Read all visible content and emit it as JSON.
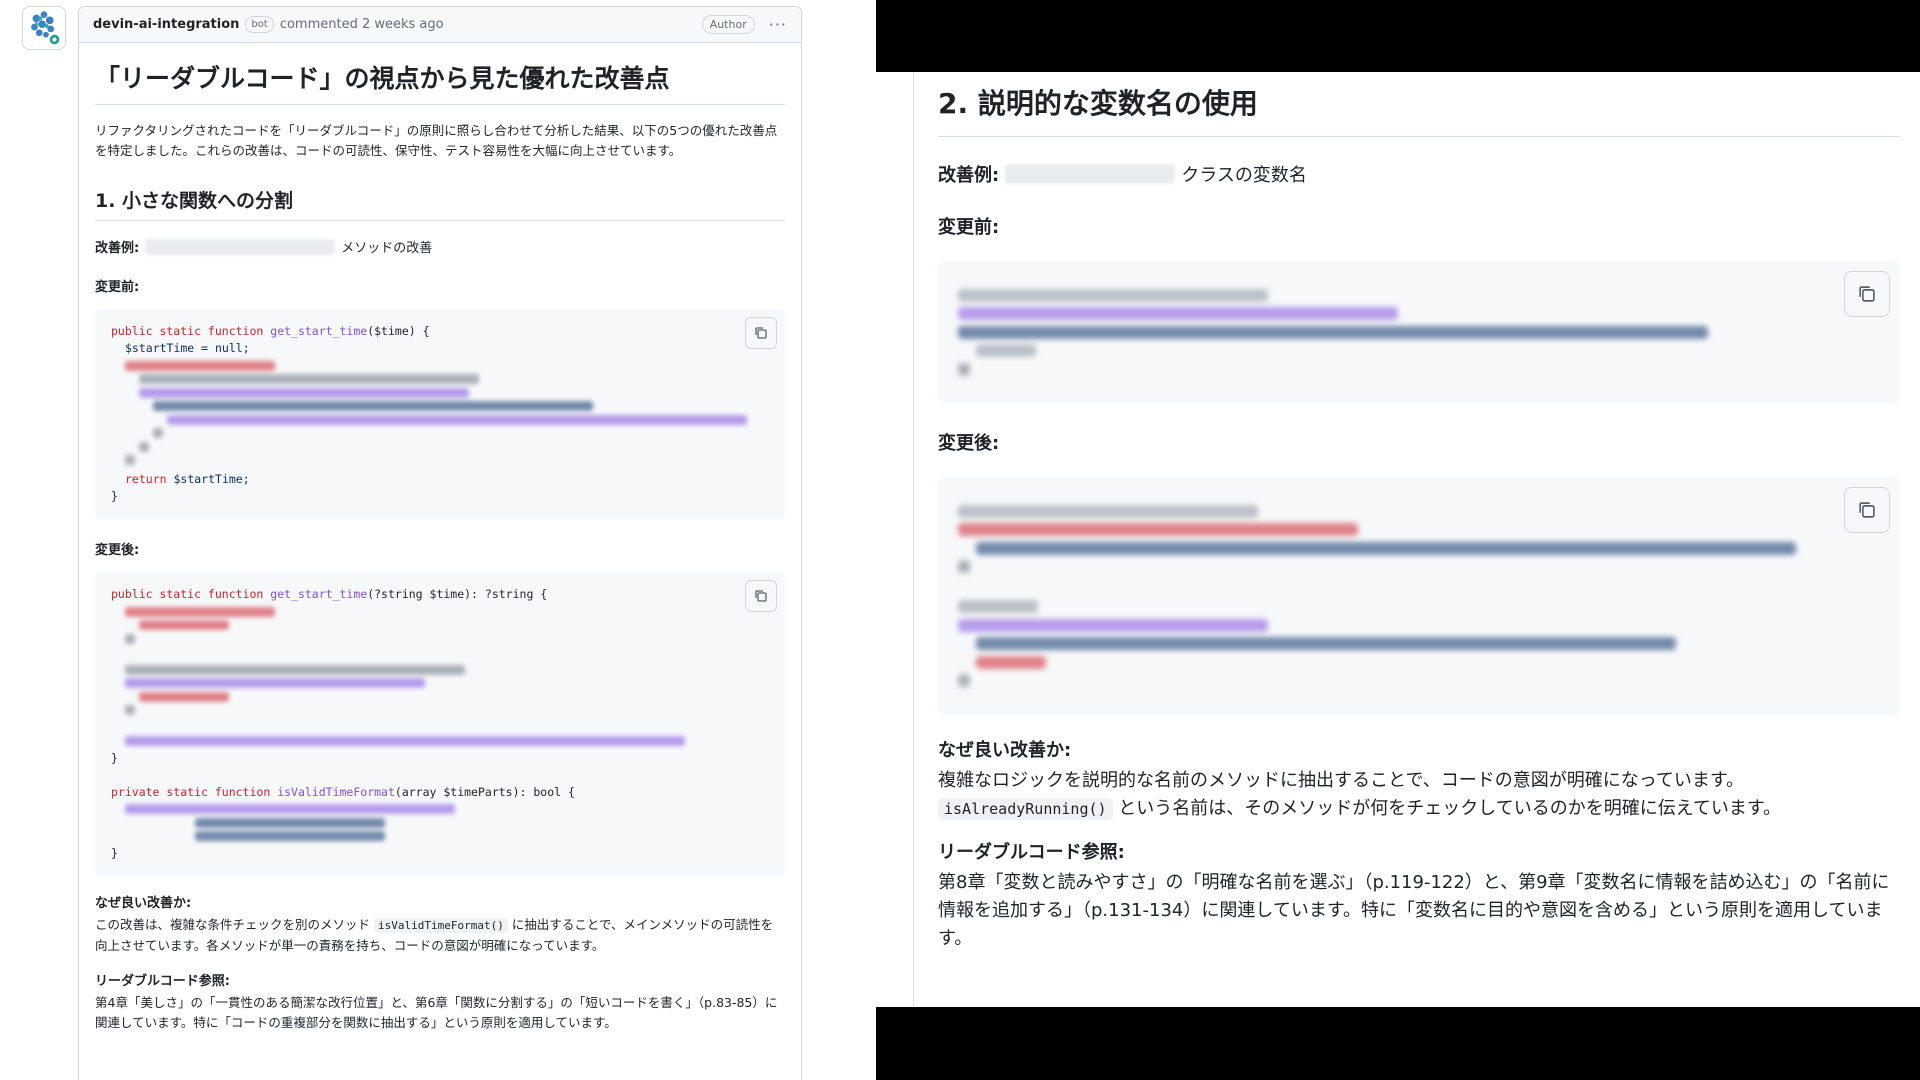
{
  "left": {
    "comment": {
      "author": "devin-ai-integration",
      "bot_badge": "bot",
      "commented": "commented 2 weeks ago",
      "author_badge": "Author",
      "more_icon": "kebab-horizontal-icon"
    },
    "title": "「リーダブルコード」の視点から見た優れた改善点",
    "intro": "リファクタリングされたコードを「リーダブルコード」の原則に照らし合わせて分析した結果、以下の5つの優れた改善点を特定しました。これらの改善は、コードの可読性、保守性、テスト容易性を大幅に向上させています。",
    "section1": {
      "heading": "1. 小さな関数への分割",
      "example_label": "改善例:",
      "example_suffix": "メソッドの改善",
      "before_label": "変更前:",
      "before_code": {
        "line1_kw": "public static function",
        "line1_fn": "get_start_time",
        "line1_rest": "($time) {",
        "line2": "$startTime = null;",
        "line_return_kw": "return",
        "line_return_rest": "$startTime;",
        "close": "}"
      },
      "after_label": "変更後:",
      "after_code": {
        "line1_kw": "public static function",
        "line1_fn": "get_start_time",
        "line1_rest": "(?string $time): ?string {",
        "close1": "}",
        "line2_kw": "private static function",
        "line2_fn": "isValidTimeFormat",
        "line2_rest": "(array $timeParts): bool {",
        "close2": "}"
      },
      "why_label": "なぜ良い改善か:",
      "why_pre": "この改善は、複雑な条件チェックを別のメソッド",
      "why_code": "isValidTimeFormat()",
      "why_post": "に抽出することで、メインメソッドの可読性を向上させています。各メソッドが単一の責務を持ち、コードの意図が明確になっています。",
      "ref_label": "リーダブルコード参照:",
      "ref_text": "第4章「美しさ」の「一貫性のある簡潔な改行位置」と、第6章「関数に分割する」の「短いコードを書く」（p.83-85）に関連しています。特に「コードの重複部分を関数に抽出する」という原則を適用しています。"
    }
  },
  "right": {
    "heading": "2. 説明的な変数名の使用",
    "example_label": "改善例:",
    "example_suffix": "クラスの変数名",
    "before_label": "変更前:",
    "after_label": "変更後:",
    "why_label": "なぜ良い改善か:",
    "why_text1": "複雑なロジックを説明的な名前のメソッドに抽出することで、コードの意図が明確になっています。",
    "why_code": "isAlreadyRunning()",
    "why_text2": "という名前は、そのメソッドが何をチェックしているのかを明確に伝えています。",
    "ref_label": "リーダブルコード参照:",
    "ref_text": "第8章「変数と読みやすさ」の「明確な名前を選ぶ」（p.119-122）と、第9章「変数名に情報を詰め込む」の「名前に情報を追加する」（p.131-134）に関連しています。特に「変数名に目的や意図を含める」という原則を適用しています。"
  },
  "icons": {
    "copy": "copy-icon",
    "avatar": "devin-avatar-icon"
  },
  "colors": {
    "keyword": "#cf222e",
    "function": "#8250df",
    "variable": "#0a3069",
    "border": "#d0d7de",
    "code_bg": "#f6f8fa"
  }
}
